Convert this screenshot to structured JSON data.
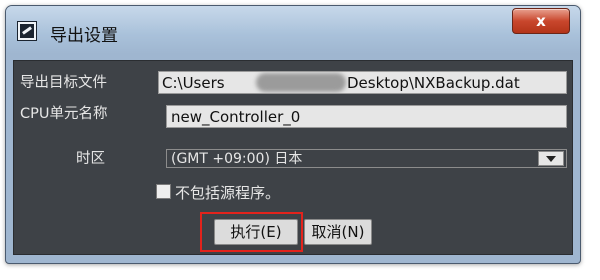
{
  "window": {
    "title": "导出设置",
    "close_label": "x"
  },
  "form": {
    "export_file": {
      "label": "导出目标文件",
      "value_prefix": "C:\\Users",
      "value_suffix": "Desktop\\NXBackup.dat"
    },
    "cpu_name": {
      "label": "CPU单元名称",
      "value": "new_Controller_0"
    },
    "timezone": {
      "label": "时区",
      "value": "(GMT +09:00) 日本"
    },
    "exclude_source": {
      "label": "不包括源程序。",
      "checked": false
    }
  },
  "buttons": {
    "execute": "执行(E)",
    "cancel": "取消(N)"
  },
  "colors": {
    "client_bg": "#3e4247",
    "highlight": "#e3231c",
    "close": "#c9472d"
  }
}
